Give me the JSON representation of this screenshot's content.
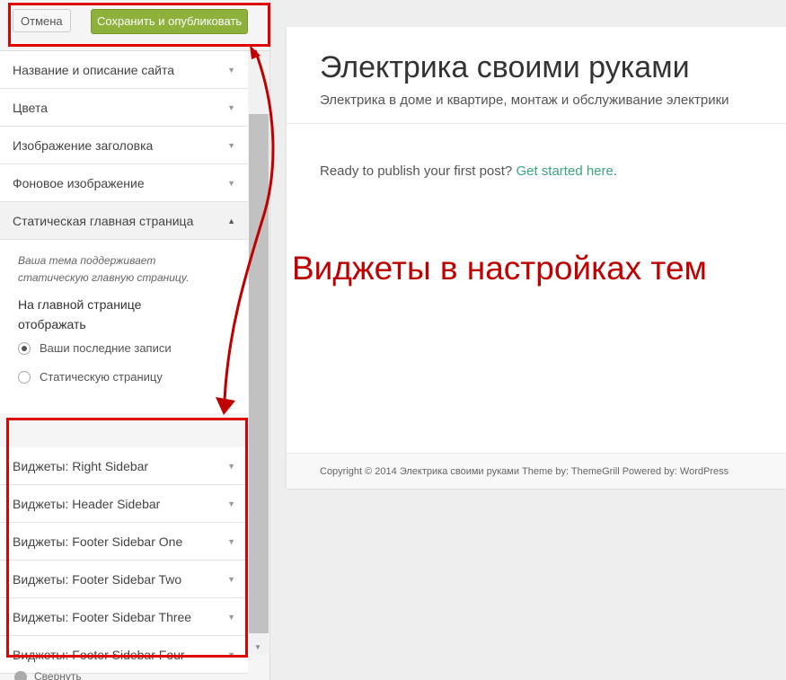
{
  "topbar": {
    "cancel_label": "Отмена",
    "save_label": "Сохранить и опубликовать"
  },
  "sections": [
    {
      "label": "Название и описание сайта"
    },
    {
      "label": "Цвета"
    },
    {
      "label": "Изображение заголовка"
    },
    {
      "label": "Фоновое изображение"
    },
    {
      "label": "Статическая главная страница"
    }
  ],
  "static_front": {
    "description": "Ваша тема поддерживает статическую главную страницу.",
    "heading": "На главной странице отображать",
    "options": [
      {
        "label": "Ваши последние записи",
        "selected": true
      },
      {
        "label": "Статическую страницу",
        "selected": false
      }
    ]
  },
  "widgets": [
    {
      "label": "Виджеты: Right Sidebar"
    },
    {
      "label": "Виджеты: Header Sidebar"
    },
    {
      "label": "Виджеты: Footer Sidebar One"
    },
    {
      "label": "Виджеты: Footer Sidebar Two"
    },
    {
      "label": "Виджеты: Footer Sidebar Three"
    },
    {
      "label": "Виджеты: Footer Sidebar Four"
    }
  ],
  "collapse_label": "Свернуть",
  "preview": {
    "site_title": "Электрика своими руками",
    "site_description": "Электрика в доме и квартире, монтаж и обслуживание электрики",
    "publish_text": "Ready to publish your first post? ",
    "publish_link": "Get started here",
    "publish_end": ".",
    "footer": "Copyright © 2014 Электрика своими руками Theme by: ThemeGrill Powered by: WordPress"
  },
  "annotation": "Виджеты в настройках тем",
  "colors": {
    "accent_green": "#8eb13c",
    "annotation_red": "#c00000",
    "link_green": "#3aa57a"
  }
}
